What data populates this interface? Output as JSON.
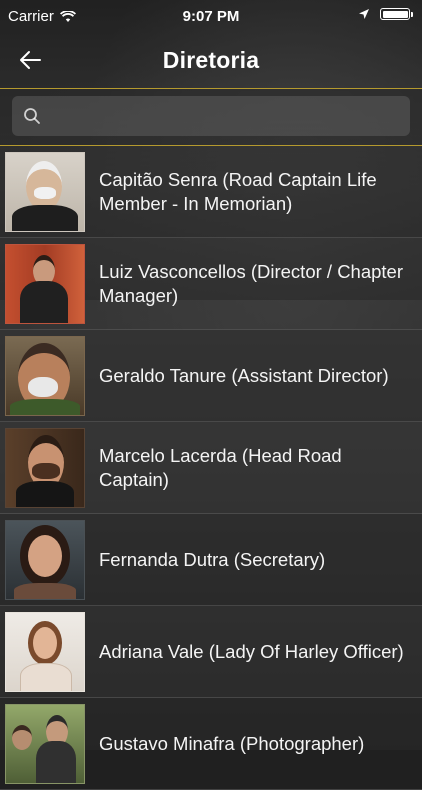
{
  "status_bar": {
    "carrier": "Carrier",
    "time": "9:07 PM",
    "icons": [
      "wifi-icon",
      "location-arrow-icon",
      "battery-icon"
    ]
  },
  "navbar": {
    "title": "Diretoria",
    "back_icon": "arrow-left-icon"
  },
  "search": {
    "placeholder": "",
    "value": "",
    "icon": "search-icon",
    "accent_color": "#b59a2e"
  },
  "members": [
    {
      "name": "Capitão Senra (Road Captain Life Member - In Memorian)"
    },
    {
      "name": "Luiz Vasconcellos (Director / Chapter Manager)"
    },
    {
      "name": "Geraldo Tanure (Assistant Director)"
    },
    {
      "name": "Marcelo Lacerda (Head Road Captain)"
    },
    {
      "name": "Fernanda Dutra (Secretary)"
    },
    {
      "name": "Adriana Vale (Lady Of Harley Officer)"
    },
    {
      "name": "Gustavo Minafra (Photographer)"
    }
  ]
}
